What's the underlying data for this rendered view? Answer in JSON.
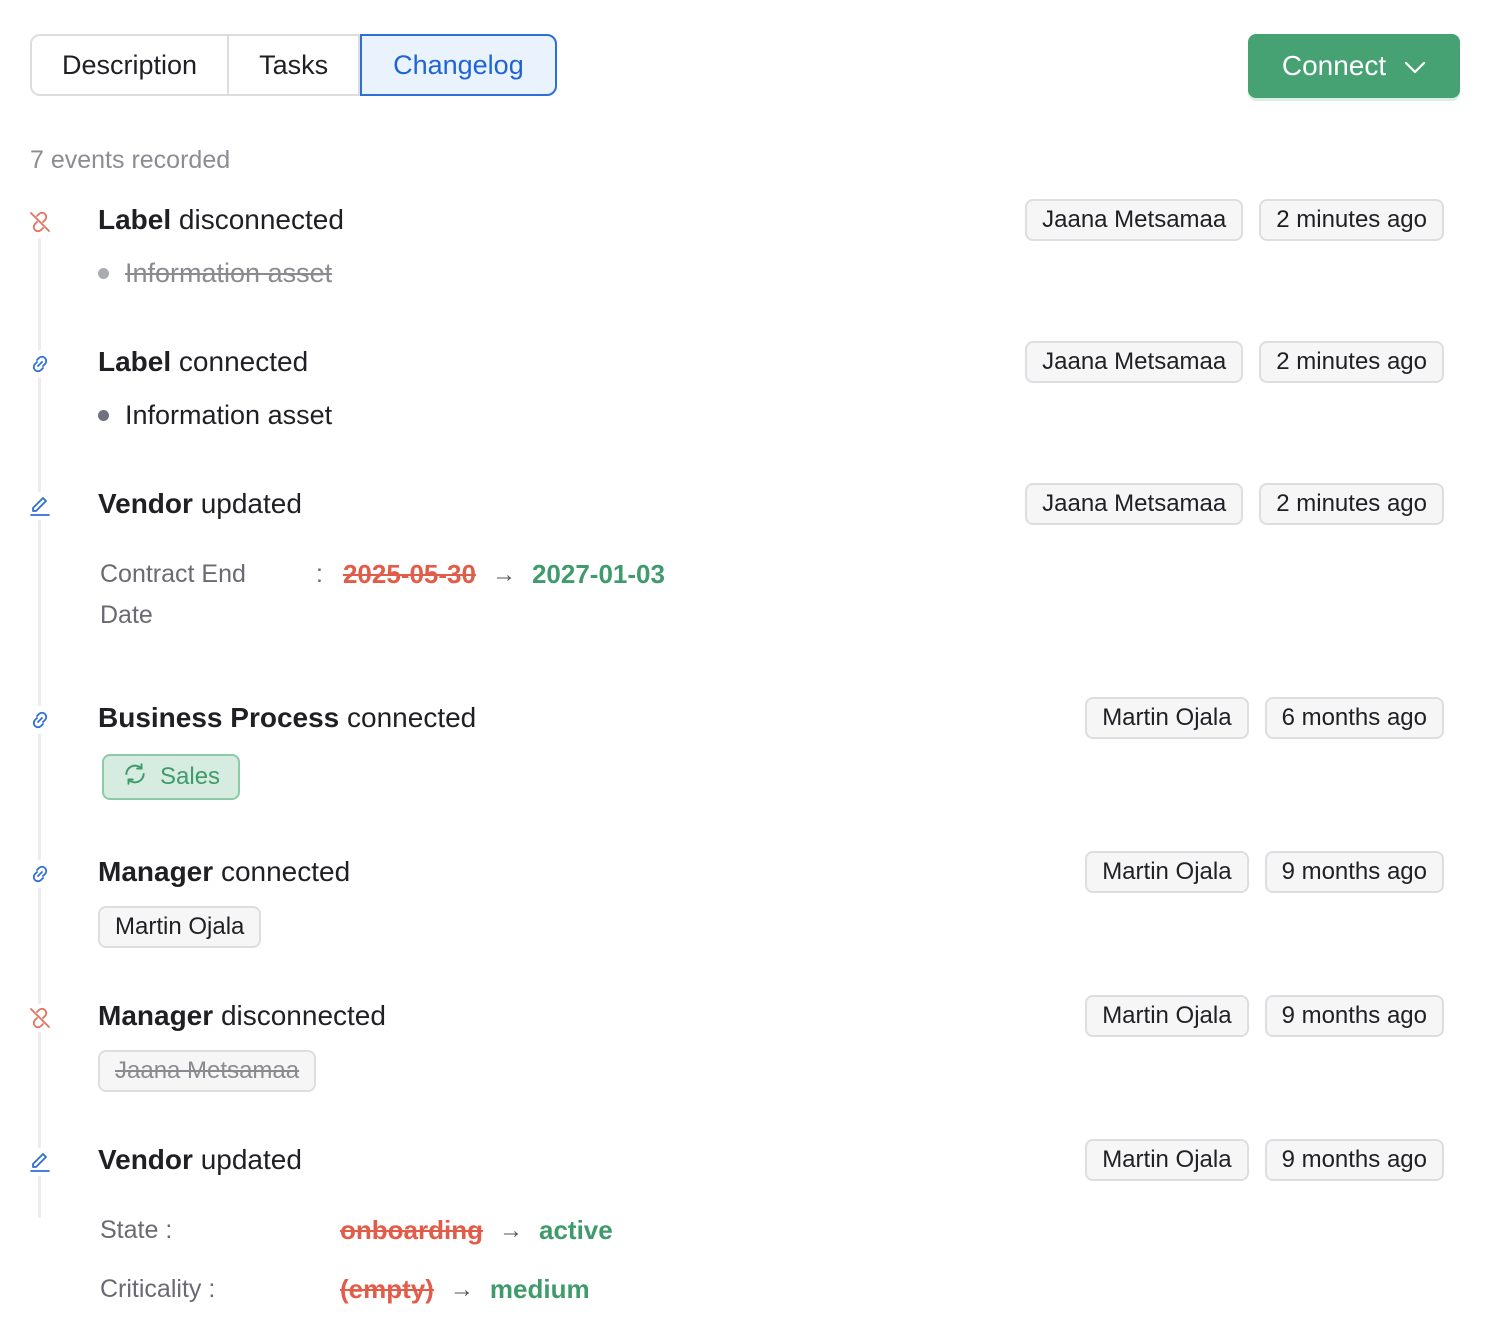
{
  "tabs": [
    {
      "label": "Description",
      "active": false
    },
    {
      "label": "Tasks",
      "active": false
    },
    {
      "label": "Changelog",
      "active": true
    }
  ],
  "connect": {
    "label": "Connect",
    "color": "#46a173"
  },
  "events_count": "7 events recorded",
  "colors": {
    "accent_blue": "#2e6fd6",
    "removed_red": "#e25c4a",
    "added_green": "#3f9a6c"
  },
  "events": [
    {
      "icon": "unlink-icon",
      "subject": "Label",
      "action": "disconnected",
      "user": "Jaana Metsamaa",
      "time": "2 minutes ago",
      "item": "Information asset"
    },
    {
      "icon": "link-icon",
      "subject": "Label",
      "action": "connected",
      "user": "Jaana Metsamaa",
      "time": "2 minutes ago",
      "item": "Information asset"
    },
    {
      "icon": "pencil-icon",
      "subject": "Vendor",
      "action": "updated",
      "user": "Jaana Metsamaa",
      "time": "2 minutes ago",
      "changes": [
        {
          "label_line1": "Contract End",
          "label_line2": "Date",
          "sep": ":",
          "old": "2025-05-30",
          "new": "2027-01-03"
        }
      ]
    },
    {
      "icon": "link-icon",
      "subject": "Business Process",
      "action": "connected",
      "user": "Martin Ojala",
      "time": "6 months ago",
      "item": "Sales"
    },
    {
      "icon": "link-icon",
      "subject": "Manager",
      "action": "connected",
      "user": "Martin Ojala",
      "time": "9 months ago",
      "item": "Martin Ojala"
    },
    {
      "icon": "unlink-icon",
      "subject": "Manager",
      "action": "disconnected",
      "user": "Martin Ojala",
      "time": "9 months ago",
      "item": "Jaana Metsamaa"
    },
    {
      "icon": "pencil-icon",
      "subject": "Vendor",
      "action": "updated",
      "user": "Martin Ojala",
      "time": "9 months ago",
      "changes": [
        {
          "label": "State",
          "sep": ":",
          "old": "onboarding",
          "new": "active"
        },
        {
          "label": "Criticality",
          "sep": ":",
          "old": "(empty)",
          "new": "medium"
        }
      ]
    }
  ]
}
